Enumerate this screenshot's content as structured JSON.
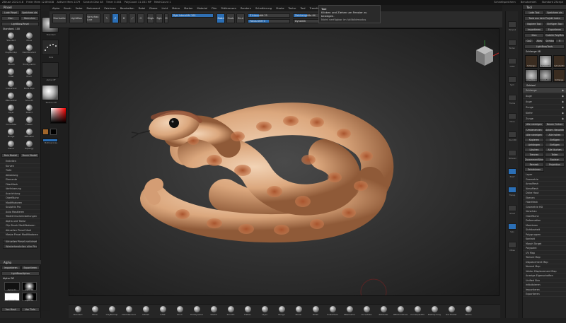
{
  "titlebar": {
    "app": "ZBrush 2022.0.8",
    "info": "Freier Mem 12.894GB",
    "active": "Aktiver Mem 2279",
    "scratch": "Scratch Disk 48",
    "timer": "Timer 0.004",
    "polys": "PolyCount 11.031 MP",
    "meshcount": "MeshCount 1",
    "right": [
      "Schnellspeichern",
      "Benutzerdef.",
      "Standard ZScript"
    ]
  },
  "menubar": {
    "items": [
      "Alpha",
      "Brush",
      "Farbe",
      "Dokument",
      "Zeichnen",
      "Bearbeiten",
      "Datei",
      "Ebene",
      "Licht",
      "Makro",
      "Marker",
      "Material",
      "Film",
      "Präferenzen",
      "Rendern",
      "Schattierung",
      "Stroke",
      "Textur",
      "Tool",
      "Transform",
      "Zplugin",
      "Zscript",
      "Hilfe"
    ]
  },
  "topshelf": {
    "buttons": [
      {
        "label": "Startseite"
      },
      {
        "label": "LightBox"
      },
      {
        "label": "Vorschau Live"
      },
      {
        "label": "Bearbeiten"
      },
      {
        "label": "Zeichnen"
      },
      {
        "label": "Bewegen"
      },
      {
        "label": "Skalieren"
      },
      {
        "label": "Drehen"
      }
    ],
    "mrgb": "Mrgb",
    "rgb": "Rgb",
    "m": "M",
    "zadd": "Zadd",
    "zsub": "Zsub",
    "zcut": "Zcut",
    "sliders": [
      {
        "label": "Rgb Intensität 100",
        "fill": 1.0
      },
      {
        "label": "Z Intensität 25",
        "fill": 0.25
      },
      {
        "label": "Fokus-Shift 0",
        "fill": 0.5
      },
      {
        "label": "Zeichengröße 64",
        "fill": 0.4
      },
      {
        "label": "Dynamik",
        "fill": 0.0
      }
    ],
    "activepoints": "Aktive Punkte: 5.512 Mil",
    "totalpoints": "Gesamtpunkte: 5.512 Mil"
  },
  "tooltip": {
    "title": "Tool",
    "text": "Klicken und Ziehen um Fenster zu bewegen.",
    "hint": "Nicht verfügbar im Vollbildmodus"
  },
  "leftpanel": {
    "header": "Pinsel",
    "buttons1": [
      "Lade Pinsel",
      "Speichern als"
    ],
    "buttons2": [
      "Klon",
      "Sternchen"
    ],
    "buttons3": [
      "LightBox▸Pinsel"
    ],
    "brushname": "Standard. 100",
    "brushes": [
      "Standard",
      "Move",
      "ClayBuildup",
      "DamStandard",
      "hPolish",
      "TrimDynamic",
      "Inflat",
      "Pinch",
      "SnakeHook",
      "Move Topo",
      "ZRemesher",
      "Smooth",
      "Layer",
      "Slash3",
      "CurveTube",
      "Flatten",
      "Nudge",
      "ZModeler",
      "Planar",
      "Topology"
    ],
    "buttons4": [
      "Rein Modell",
      "Brush Modell"
    ],
    "menu": [
      "Erstellen",
      "Kurven",
      "Tiefe",
      "Abtastung",
      "Elemente",
      "FiberMesh",
      "Verfeinerung",
      "Ausrichtung",
      "Oberfläche",
      "Modifikatoren",
      "Sculptris Pro",
      "Auto Maskieren",
      "Tablet Druckeinstellungen",
      "Alpha und Textur",
      "Clip Brush Modifikatoren",
      "Aktuellen Pinsel Modi",
      "Maske Pinsel Modifikatoren"
    ],
    "buttons5": [
      "Aktuellen Pinsel zurücksetzen",
      "Wiederherstellen aller Pinsel"
    ]
  },
  "leftstrip": {
    "labels": [
      "Standard",
      "Dots",
      "Alpha Off",
      "Texture Off",
      "MatCap Gray"
    ]
  },
  "alpha": {
    "header": "Alpha",
    "buttons": [
      "Importieren",
      "Exportieren"
    ],
    "lightbox": "LightBox▸Alphas",
    "name": "Alpha Off",
    "items": [
      "Alpha 01",
      "Alpha 02",
      "Alpha 03",
      "Alpha 04"
    ],
    "extra": [
      "Von Mask",
      "Von Tiefe"
    ]
  },
  "rightstrip": {
    "labels": [
      "Perspek",
      "Boden",
      "Lokal",
      "Sym",
      "Frame",
      "Move",
      "Zoom3D",
      "Rotieren",
      "PolyF",
      "Transp",
      "Ghost",
      "Solo",
      "XPose"
    ]
  },
  "rightpanel": {
    "header": "Tool",
    "buttons1": [
      "Lade Tool",
      "Speichern als"
    ],
    "buttons2": [
      "Tools aus dem Projekt laden"
    ],
    "buttons3": [
      "Kopiere Tool",
      "Einfügen Tool"
    ],
    "buttons4": [
      "Importieren",
      "Exportieren"
    ],
    "buttons5": [
      "Klon",
      "Erstelle PolyMesh3D"
    ],
    "buttons6": [
      "GoZ",
      "Alles",
      "Sichtbar",
      "R"
    ],
    "lightbox": "LightBox▸Tools",
    "toolname": "Schlange 48",
    "subtools": [
      "Schlange",
      "Sphere3D",
      "Cylinder3D",
      "PolyMesh3D",
      "SimpleBrush",
      "Schlange"
    ],
    "subtool_header": "Subtool",
    "subtool_list": [
      "Schlange",
      "Auge",
      "Auge",
      "Zunge",
      "Kiefer",
      "Zunge"
    ],
    "counts": {
      "visible": "Alle niedrigen",
      "count": "Neuen Ordner"
    },
    "actions": [
      "Umbenennen",
      "Autom. Neuordnung",
      "Alle niedrigen",
      "Alle hohen",
      "Kopieren",
      "Einfügen",
      "Anhängen",
      "Einfügen",
      "Löschen",
      "Alle löschen",
      "Trennen",
      "Teilen",
      "Zusammenführen",
      "Boolean",
      "Remesh",
      "Projektion",
      "Extrahieren"
    ],
    "menu": [
      "Layer",
      "Geometrie",
      "ArrayMesh",
      "NanoMesh",
      "Dicke Haut",
      "Ebenen",
      "FiberMesh",
      "Geometrie HD",
      "Vorschau",
      "Oberfläche",
      "Deformation",
      "Maskieren",
      "Sichtbarkeit",
      "Polygruppen",
      "Kontakt",
      "Morph Target",
      "Polypaint",
      "UV Map",
      "Texture Map",
      "Displacement Map",
      "Normal Map",
      "Vektor Displacement Map",
      "Anzeige-Eigenschaften",
      "Unified Skin",
      "Initialisieren",
      "Importieren",
      "Exportieren"
    ]
  },
  "bottomshelf": {
    "items": [
      "Standard",
      "Move",
      "ClayBuildup",
      "DamStandard",
      "hPolish",
      "Inflat",
      "Pinch",
      "TrimDynamic",
      "Slash3",
      "Smooth",
      "Flatten",
      "Layer",
      "Nudge",
      "Planar",
      "Polish",
      "SnakeHook",
      "ZRemesher",
      "CurveTube",
      "ZModeler",
      "IMM Primitives",
      "CurveQuadFill",
      "MatCap Gray",
      "Rot Shader",
      "Wachs"
    ]
  },
  "colors": {
    "accent": "#2b6fb6",
    "snake_base": "#e3b48f",
    "snake_spots": "#b5653e",
    "background": "#1f1f1f"
  }
}
